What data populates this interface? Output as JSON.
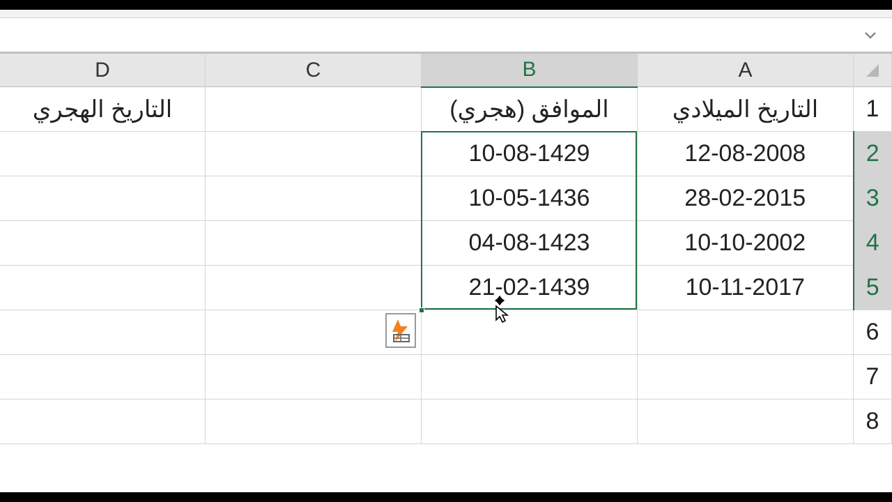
{
  "formula_bar": {
    "value": ""
  },
  "columns": [
    "A",
    "B",
    "C",
    "D"
  ],
  "selected_column": "B",
  "selected_rows": [
    2,
    3,
    4,
    5
  ],
  "row_numbers": [
    1,
    2,
    3,
    4,
    5,
    6,
    7,
    8
  ],
  "headers": {
    "A": "التاريخ الميلادي",
    "B": "الموافق (هجري)",
    "C": "",
    "D": "التاريخ الهجري"
  },
  "rows": [
    {
      "A": "12-08-2008",
      "B": "10-08-1429",
      "C": "",
      "D": ""
    },
    {
      "A": "28-02-2015",
      "B": "10-05-1436",
      "C": "",
      "D": ""
    },
    {
      "A": "10-10-2002",
      "B": "04-08-1423",
      "C": "",
      "D": ""
    },
    {
      "A": "10-11-2017",
      "B": "21-02-1439",
      "C": "",
      "D": ""
    }
  ],
  "flash_fill_icon": "flash-fill",
  "colors": {
    "selection": "#217346"
  }
}
